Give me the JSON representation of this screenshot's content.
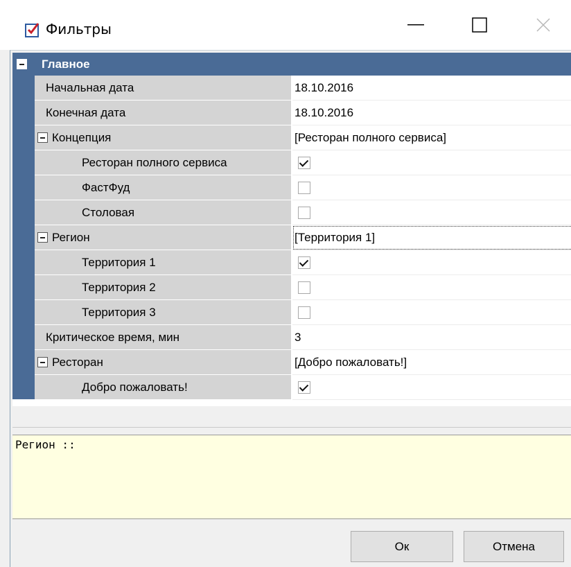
{
  "window": {
    "title": "Фильтры",
    "icon": "checked-filter-icon",
    "controls": {
      "minimize": "—",
      "maximize": "☐",
      "close": "✕"
    }
  },
  "grid": {
    "category": "Главное",
    "rows": [
      {
        "label": "Начальная дата",
        "value": "18.10.2016"
      },
      {
        "label": "Конечная дата",
        "value": "18.10.2016"
      },
      {
        "label": "Концепция",
        "value": "[Ресторан полного сервиса]",
        "expanded": true
      },
      {
        "label": "Ресторан полного сервиса",
        "checked": true
      },
      {
        "label": "ФастФуд",
        "checked": false
      },
      {
        "label": "Столовая",
        "checked": false
      },
      {
        "label": "Регион",
        "value": "[Территория 1]",
        "expanded": true,
        "selected": true
      },
      {
        "label": "Территория 1",
        "checked": true
      },
      {
        "label": "Территория 2",
        "checked": false
      },
      {
        "label": "Территория 3",
        "checked": false
      },
      {
        "label": "Критическое время, мин",
        "value": "3"
      },
      {
        "label": "Ресторан",
        "value": "[Добро пожаловать!]",
        "expanded": true
      },
      {
        "label": "Добро пожаловать!",
        "checked": true
      }
    ]
  },
  "description": {
    "text": "Регион ::"
  },
  "buttons": {
    "ok": "Ок",
    "cancel": "Отмена"
  },
  "colors": {
    "category_bar": "#4a6b96",
    "label_bg": "#d4d4d4",
    "description_bg": "#ffffe1"
  }
}
